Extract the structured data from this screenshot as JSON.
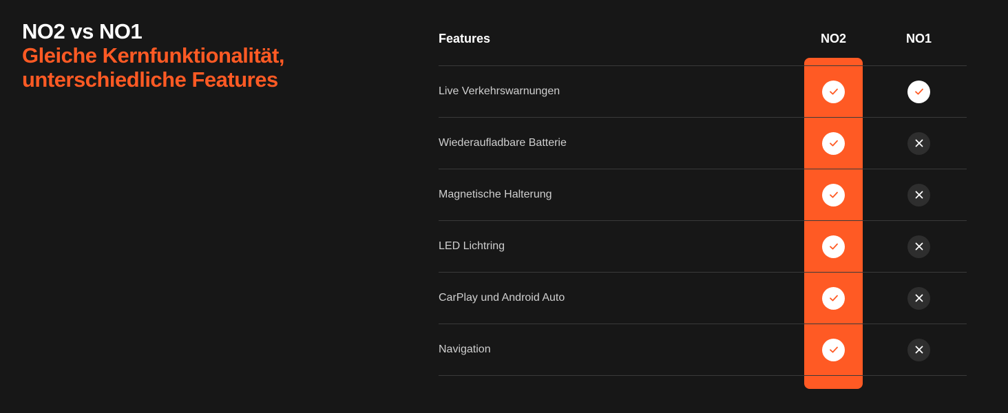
{
  "headline": {
    "title": "NO2 vs NO1",
    "subtitle_line1": "Gleiche Kernfunktionalität,",
    "subtitle_line2": "unterschiedliche Features"
  },
  "table": {
    "header": {
      "features": "Features",
      "no2": "NO2",
      "no1": "NO1"
    },
    "rows": [
      {
        "label": "Live Verkehrswarnungen",
        "no2": "check",
        "no1": "check"
      },
      {
        "label": "Wiederaufladbare Batterie",
        "no2": "check",
        "no1": "cross"
      },
      {
        "label": "Magnetische Halterung",
        "no2": "check",
        "no1": "cross"
      },
      {
        "label": "LED Lichtring",
        "no2": "check",
        "no1": "cross"
      },
      {
        "label": "CarPlay und Android Auto",
        "no2": "check",
        "no1": "cross"
      },
      {
        "label": "Navigation",
        "no2": "check",
        "no1": "cross"
      }
    ]
  },
  "colors": {
    "background": "#171717",
    "accent": "#ff5a24",
    "check_badge": "#ffffff",
    "cross_badge": "#2e2e2e"
  },
  "icons": {
    "check": "check-icon",
    "cross": "close-icon"
  }
}
